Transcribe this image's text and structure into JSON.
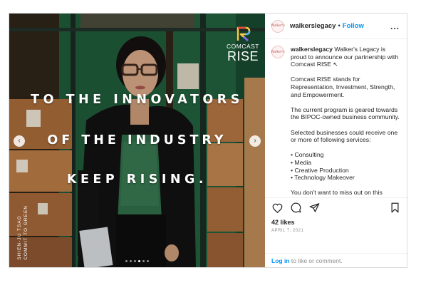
{
  "post": {
    "overlay": {
      "line1": "TO THE INNOVATORS",
      "line2": "OF THE INDUSTRY",
      "line3": "KEEP RISING."
    },
    "brand": {
      "name": "COMCAST",
      "sub": "RISE"
    },
    "credit": [
      "SHIEN-JU TSAO",
      "COMMIT TO GREEN"
    ],
    "carousel": {
      "total_dots": 6,
      "active_index": 3
    }
  },
  "sidebar": {
    "username": "walkerslegacy",
    "separator": "•",
    "follow_label": "Follow",
    "more_label": "...",
    "avatar_text": "Walker's",
    "caption": {
      "username": "walkerslegacy",
      "intro": "Walker's Legacy is proud to announce our partnership with Comcast RISE ↖",
      "para1": "Comcast RISE stands for Representation, Investment, Strength, and Empowerment.",
      "para2": "The current program is geared towards the BIPOC-owned business community.",
      "para3": "Selected businesses could receive one or more of following services:",
      "services": [
        "• Consulting",
        "• Media",
        "• Creative Production",
        "• Technology Makeover"
      ],
      "para4": "You don't want to miss out on this opportunity!"
    },
    "likes": "42 likes",
    "date": "APRIL 7, 2021",
    "login": {
      "link": "Log in",
      "rest": " to like or comment."
    }
  },
  "icons": {
    "like": "heart-icon",
    "comment": "comment-icon",
    "share": "paper-plane-icon",
    "save": "bookmark-icon"
  }
}
